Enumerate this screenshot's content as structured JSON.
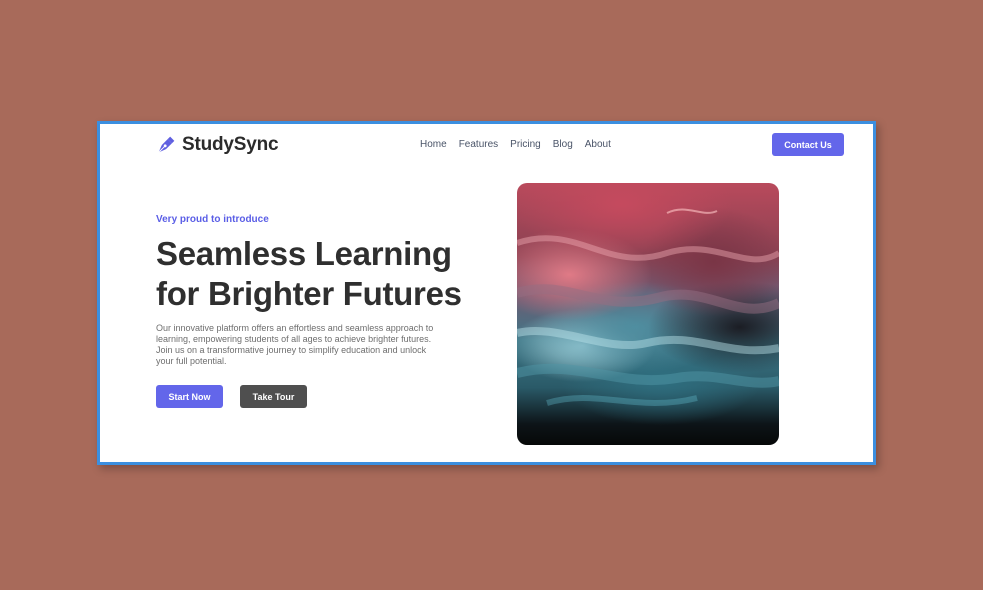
{
  "brand": {
    "name": "StudySync",
    "icon": "pen-nib-icon",
    "accent": "#6366ea"
  },
  "nav": {
    "items": [
      {
        "label": "Home"
      },
      {
        "label": "Features"
      },
      {
        "label": "Pricing"
      },
      {
        "label": "Blog"
      },
      {
        "label": "About"
      }
    ],
    "contact_label": "Contact Us"
  },
  "hero": {
    "eyebrow": "Very proud to introduce",
    "headline_line1": "Seamless Learning",
    "headline_line2": "for Brighter Futures",
    "description": "Our innovative platform offers an effortless and seamless approach to learning, empowering students of all ages to achieve brighter futures. Join us on a transformative journey to simplify education and unlock your full potential.",
    "primary_button": "Start Now",
    "secondary_button": "Take Tour",
    "image": "abstract-ink-fluid-art-image"
  },
  "colors": {
    "background": "#a86a5a",
    "frame_border": "#3b8fe0",
    "primary": "#6366ea",
    "secondary": "#4f4f4f"
  }
}
